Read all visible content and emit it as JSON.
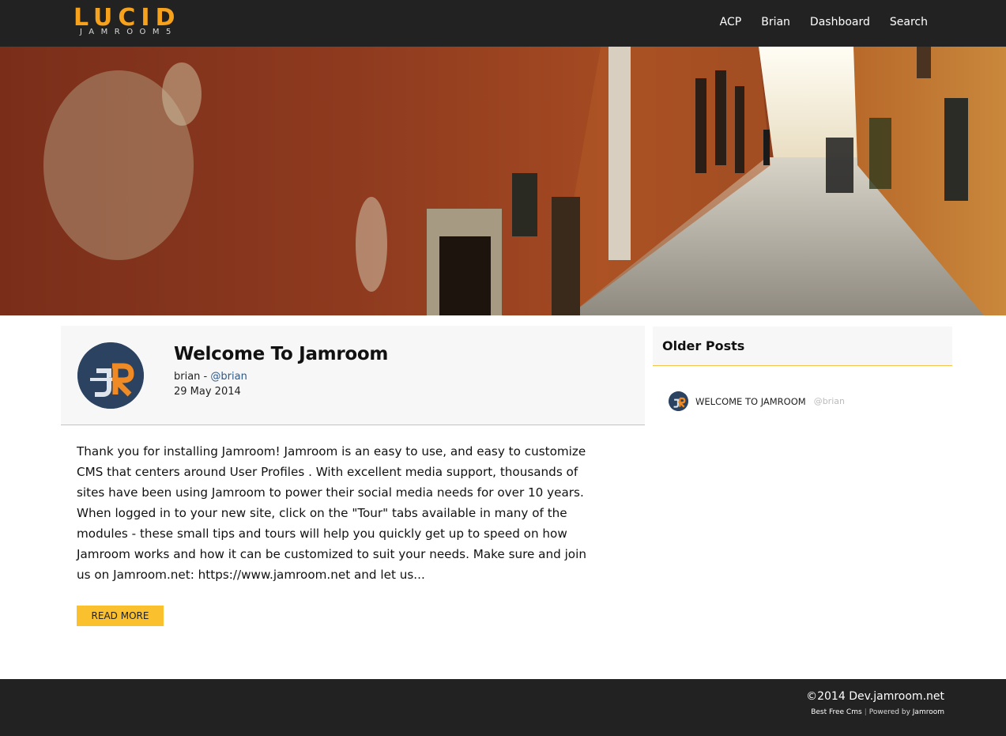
{
  "header": {
    "logo_main": "LUCID",
    "logo_sub": "JAMROOM5",
    "nav": [
      "ACP",
      "Brian",
      "Dashboard",
      "Search"
    ]
  },
  "post": {
    "title": "Welcome To Jamroom",
    "author": "brian",
    "author_sep": " - ",
    "handle": "@brian",
    "date": "29 May 2014",
    "body": "Thank you for installing Jamroom! Jamroom is an easy to use, and easy to customize CMS that centers around User Profiles . With excellent media support, thousands of sites have been using Jamroom to power their social media needs for over 10 years. When logged in to your new site, click on the \"Tour\" tabs available in many of the modules - these small tips and tours will help you quickly get up to speed on how Jamroom works and how it can be customized to suit your needs. Make sure and join us on Jamroom.net: https://www.jamroom.net and let us...",
    "read_more": "READ MORE"
  },
  "sidebar": {
    "title": "Older Posts",
    "items": [
      {
        "title": "WELCOME TO JAMROOM",
        "handle": "@brian"
      }
    ]
  },
  "footer": {
    "copyright": "©2014",
    "site": "Dev.jamroom.net",
    "link1": "Best Free Cms",
    "sep": "|",
    "powered": "Powered by",
    "powered_brand": "Jamroom"
  },
  "colors": {
    "bar": "#222222",
    "accent": "#fbc02d",
    "logo": "#f7a21c",
    "link": "#2a5a8c"
  }
}
